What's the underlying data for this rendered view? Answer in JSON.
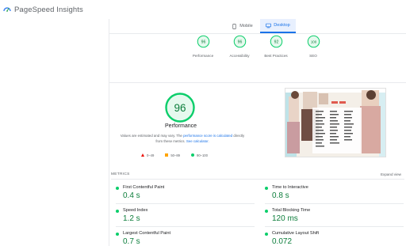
{
  "app": {
    "title": "PageSpeed Insights"
  },
  "tabs": [
    {
      "label": "Mobile",
      "icon": "phone-icon",
      "active": false
    },
    {
      "label": "Desktop",
      "icon": "desktop-icon",
      "active": true
    }
  ],
  "summary": [
    {
      "label": "Performance",
      "score": "96"
    },
    {
      "label": "Accessibility",
      "score": "96"
    },
    {
      "label": "Best Practices",
      "score": "92"
    },
    {
      "label": "SEO",
      "score": "100"
    }
  ],
  "performance": {
    "score": "96",
    "title": "Performance",
    "disclaimer_part1": "Values are estimated and may vary. The ",
    "disclaimer_link1": "performance score is calculated",
    "disclaimer_part2": " directly from these metrics. ",
    "disclaimer_link2": "See calculator."
  },
  "legend": [
    {
      "range": "0–49",
      "shape": "triangle",
      "color": "#eb0f00"
    },
    {
      "range": "50–89",
      "shape": "square",
      "color": "#ffa400"
    },
    {
      "range": "90–100",
      "shape": "circle",
      "color": "#0cce6b"
    }
  ],
  "metrics": {
    "section_label": "METRICS",
    "expand_label": "Expand view",
    "items": [
      {
        "name": "First Contentful Paint",
        "value": "0.4 s"
      },
      {
        "name": "Time to Interactive",
        "value": "0.8 s"
      },
      {
        "name": "Speed Index",
        "value": "1.2 s"
      },
      {
        "name": "Total Blocking Time",
        "value": "120 ms"
      },
      {
        "name": "Largest Contentful Paint",
        "value": "0.7 s"
      },
      {
        "name": "Cumulative Layout Shift",
        "value": "0.072"
      }
    ]
  },
  "colors": {
    "pass": "#0cce6b",
    "pass_text": "#0c7d3b",
    "accent": "#1a73e8"
  }
}
